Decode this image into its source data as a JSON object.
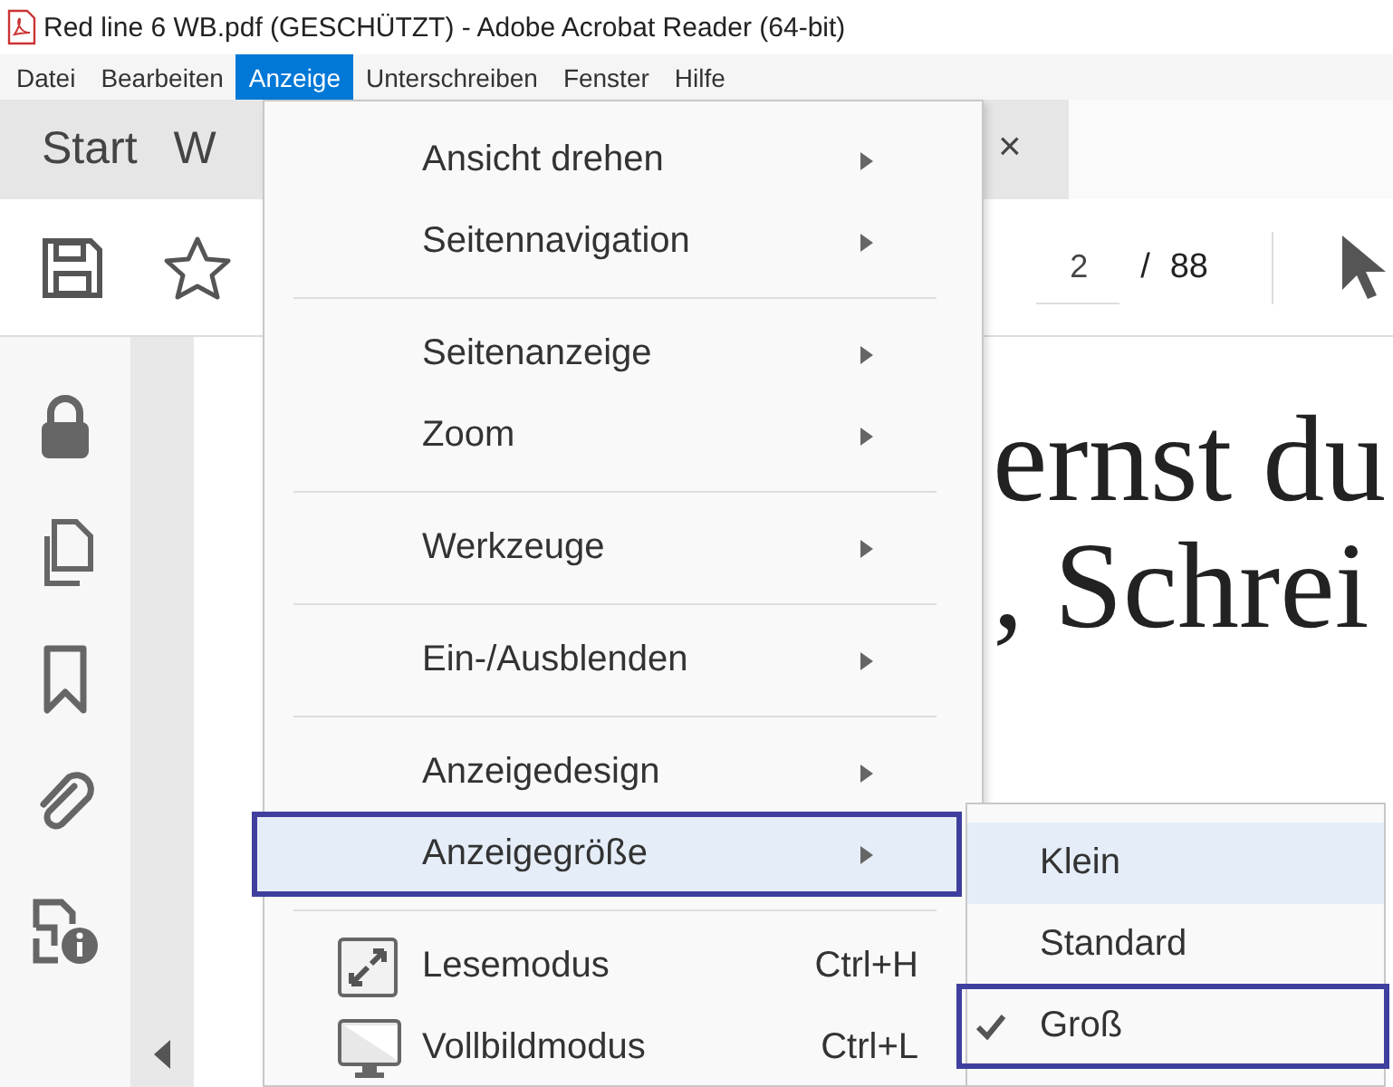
{
  "window": {
    "title": "Red line 6 WB.pdf (GESCHÜTZT) - Adobe Acrobat Reader (64-bit)"
  },
  "menu_bar": [
    {
      "label": "Datei",
      "selected": false
    },
    {
      "label": "Bearbeiten",
      "selected": false
    },
    {
      "label": "Anzeige",
      "selected": true
    },
    {
      "label": "Unterschreiben",
      "selected": false
    },
    {
      "label": "Fenster",
      "selected": false
    },
    {
      "label": "Hilfe",
      "selected": false
    }
  ],
  "tabs": [
    {
      "label": "Start",
      "selected": false
    },
    {
      "label": "W",
      "selected": false
    }
  ],
  "tab_close": "×",
  "toolbar": {
    "page_field": {
      "value": "2"
    },
    "page_separator": "/",
    "page_total": "88"
  },
  "document_text": [
    "ernst du",
    ", Schrei"
  ],
  "view_menu": [
    {
      "kind": "submenu",
      "label": "Ansicht drehen",
      "selected": false,
      "framed": false
    },
    {
      "kind": "submenu",
      "label": "Seitennavigation",
      "selected": false,
      "framed": false
    },
    {
      "kind": "separator"
    },
    {
      "kind": "submenu",
      "label": "Seitenanzeige",
      "selected": false,
      "framed": false
    },
    {
      "kind": "submenu",
      "label": "Zoom",
      "selected": false,
      "framed": false
    },
    {
      "kind": "separator"
    },
    {
      "kind": "submenu",
      "label": "Werkzeuge",
      "selected": false,
      "framed": false
    },
    {
      "kind": "separator"
    },
    {
      "kind": "submenu",
      "label": "Ein-/Ausblenden",
      "selected": false,
      "framed": false
    },
    {
      "kind": "separator"
    },
    {
      "kind": "submenu",
      "label": "Anzeigedesign",
      "selected": false,
      "framed": false
    },
    {
      "kind": "submenu",
      "label": "Anzeigegröße",
      "selected": true,
      "framed": true
    },
    {
      "kind": "separator"
    },
    {
      "kind": "command",
      "label": "Lesemodus",
      "shortcut": "Ctrl+H",
      "selected": false,
      "framed": false
    },
    {
      "kind": "command",
      "label": "Vollbildmodus",
      "shortcut": "Ctrl+L",
      "selected": false,
      "framed": false
    }
  ],
  "size_submenu": [
    {
      "label": "Klein",
      "selected": true,
      "checked": false,
      "framed": false
    },
    {
      "label": "Standard",
      "selected": false,
      "checked": false,
      "framed": false
    },
    {
      "label": "Groß",
      "selected": false,
      "checked": true,
      "framed": true
    }
  ]
}
